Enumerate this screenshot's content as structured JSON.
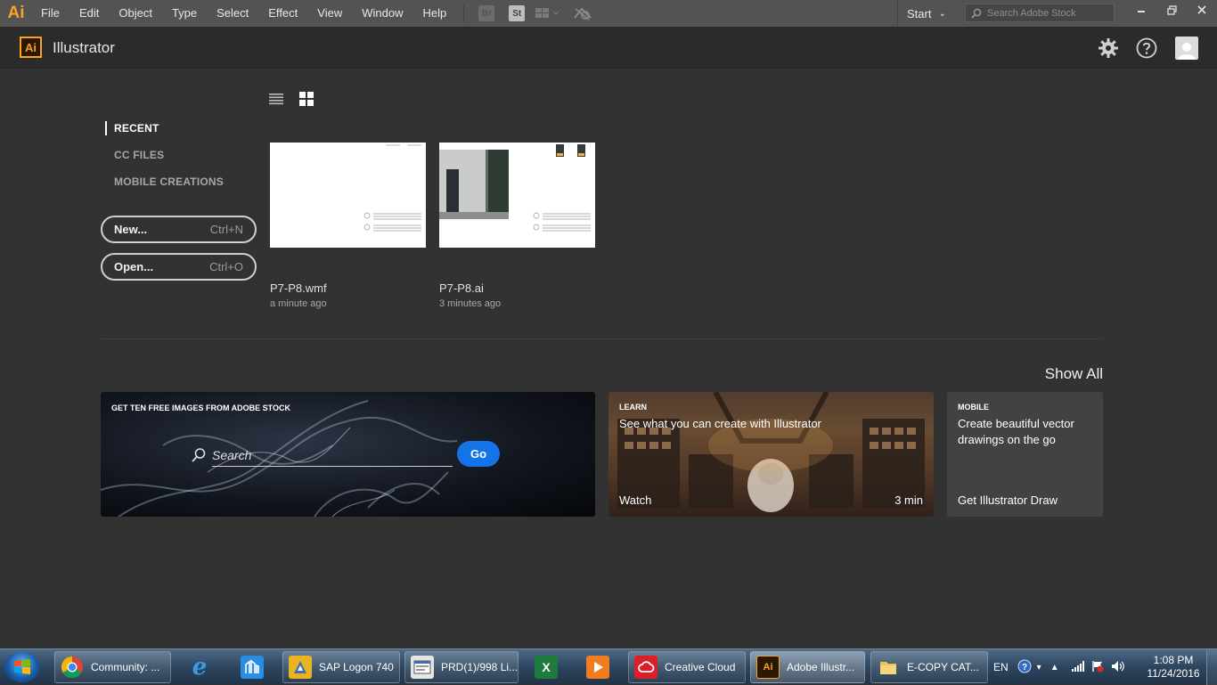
{
  "menubar": {
    "logo": "Ai",
    "items": [
      "File",
      "Edit",
      "Object",
      "Type",
      "Select",
      "Effect",
      "View",
      "Window",
      "Help"
    ],
    "bridge_badge": "Br",
    "stock_badge": "St",
    "workspace": "Start",
    "search_placeholder": "Search Adobe Stock"
  },
  "header": {
    "badge": "Ai",
    "app_name": "Illustrator"
  },
  "nav": {
    "items": [
      "RECENT",
      "CC FILES",
      "MOBILE CREATIONS"
    ],
    "active": "RECENT"
  },
  "actions": {
    "new_label": "New...",
    "new_shortcut": "Ctrl+N",
    "open_label": "Open...",
    "open_shortcut": "Ctrl+O"
  },
  "recent_files": [
    {
      "name": "P7-P8.wmf",
      "time": "a minute ago"
    },
    {
      "name": "P7-P8.ai",
      "time": "3 minutes ago"
    }
  ],
  "show_all": "Show All",
  "stock_card": {
    "title": "GET TEN FREE IMAGES FROM ADOBE STOCK",
    "search_placeholder": "Search",
    "go_label": "Go"
  },
  "learn_card": {
    "kicker": "LEARN",
    "headline": "See what you can create with Illustrator",
    "cta": "Watch",
    "duration": "3 min"
  },
  "mobile_card": {
    "kicker": "MOBILE",
    "headline": "Create beautiful vector drawings on the go",
    "cta": "Get Illustrator Draw"
  },
  "taskbar": {
    "items": [
      {
        "label": "Community: ..."
      },
      {
        "label": ""
      },
      {
        "label": ""
      },
      {
        "label": "SAP Logon 740"
      },
      {
        "label": "PRD(1)/998 Li..."
      },
      {
        "label": ""
      },
      {
        "label": ""
      },
      {
        "label": "Creative Cloud"
      },
      {
        "label": "Adobe Illustr..."
      },
      {
        "label": "E-COPY CAT..."
      }
    ],
    "language": "EN",
    "time": "1:08 PM",
    "date": "11/24/2016"
  },
  "colors": {
    "brand": "#f7a325",
    "accent_blue": "#1473e6",
    "background": "#323232"
  }
}
